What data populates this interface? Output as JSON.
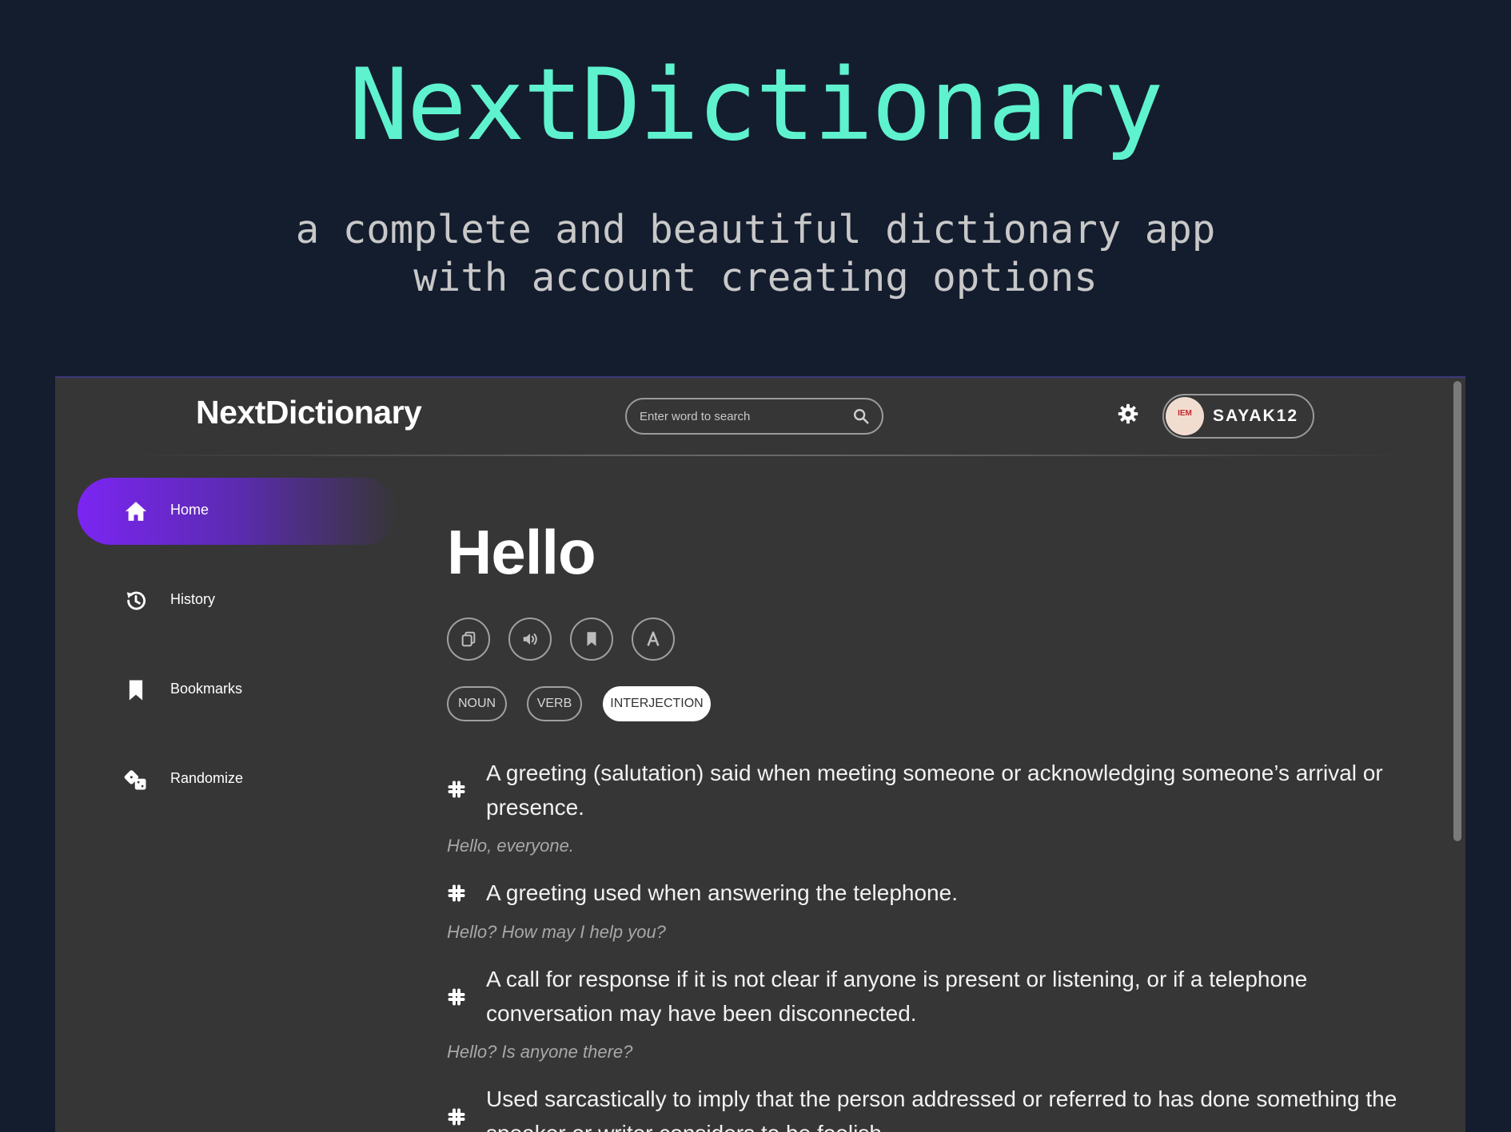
{
  "promo": {
    "title": "NextDictionary",
    "subtitle_line1": "a complete and beautiful dictionary app",
    "subtitle_line2": "with account creating options"
  },
  "header": {
    "logo": "NextDictionary",
    "search_placeholder": "Enter word to search",
    "settings_icon": "gear-icon",
    "user": {
      "name": "SAYAK12",
      "avatar_text": "IEM"
    }
  },
  "sidebar": {
    "items": [
      {
        "label": "Home",
        "icon": "home-icon",
        "active": true
      },
      {
        "label": "History",
        "icon": "history-icon",
        "active": false
      },
      {
        "label": "Bookmarks",
        "icon": "bookmark-icon",
        "active": false
      },
      {
        "label": "Randomize",
        "icon": "dice-icon",
        "active": false
      }
    ]
  },
  "entry": {
    "word": "Hello",
    "actions": [
      "copy-icon",
      "speaker-icon",
      "bookmark-icon",
      "font-icon"
    ],
    "parts_of_speech": [
      {
        "label": "NOUN",
        "active": false
      },
      {
        "label": "VERB",
        "active": false
      },
      {
        "label": "INTERJECTION",
        "active": true
      }
    ],
    "definitions": [
      {
        "text": "A greeting (salutation) said when meeting someone or acknowledging someone’s arrival or presence.",
        "example": "Hello, everyone."
      },
      {
        "text": "A greeting used when answering the telephone.",
        "example": "Hello? How may I help you?"
      },
      {
        "text": "A call for response if it is not clear if anyone is present or listening, or if a telephone conversation may have been disconnected.",
        "example": "Hello? Is anyone there?"
      },
      {
        "text": "Used sarcastically to imply that the person addressed or referred to has done something the speaker or writer considers to be foolish."
      }
    ]
  },
  "colors": {
    "background": "#141d2e",
    "title_accent": "#5ff2cf",
    "app_bg": "#363636",
    "active_nav": "#7b25f2"
  }
}
